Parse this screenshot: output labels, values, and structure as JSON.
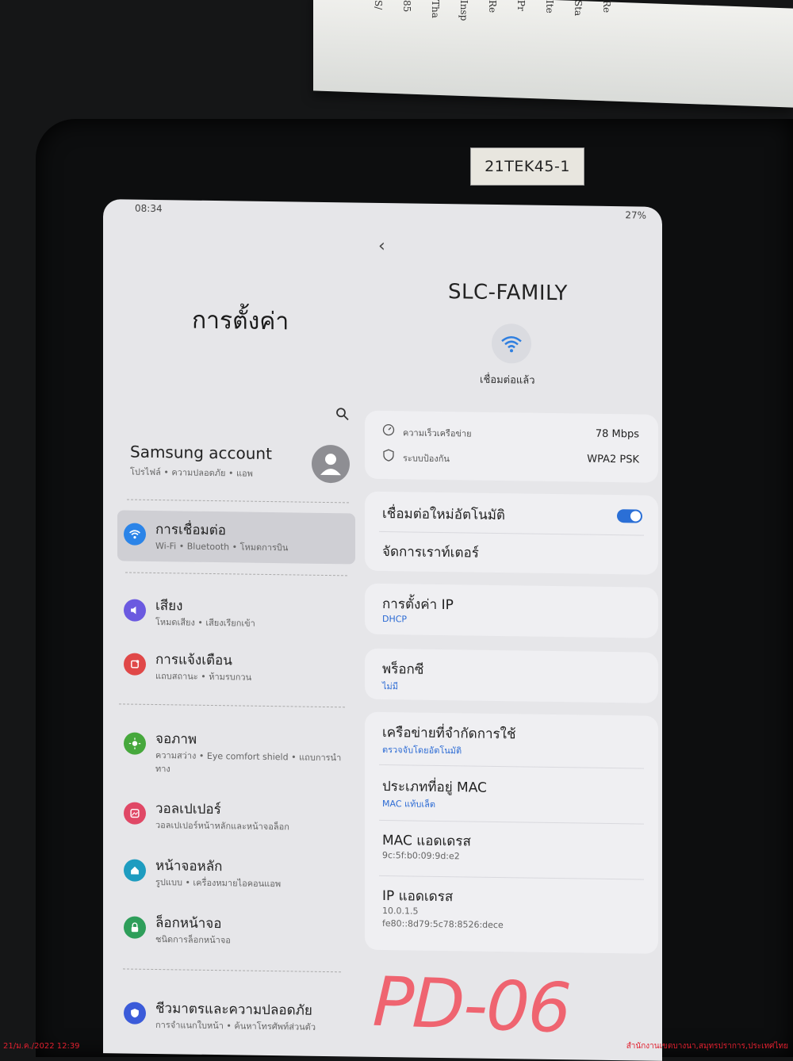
{
  "device_label": "21TEK45-1",
  "status_bar": {
    "time": "08:34",
    "battery": "27%"
  },
  "settings": {
    "title": "การตั้งค่า",
    "account": {
      "title": "Samsung account",
      "subtitle": "โปรไฟล์ • ความปลอดภัย • แอพ"
    },
    "items": [
      {
        "title": "การเชื่อมต่อ",
        "subtitle": "Wi-Fi • Bluetooth • โหมดการบิน",
        "icon": "wifi-icon",
        "color": "#2b84e8"
      },
      {
        "title": "เสียง",
        "subtitle": "โหมดเสียง • เสียงเรียกเข้า",
        "icon": "speaker-icon",
        "color": "#6b5ae0"
      },
      {
        "title": "การแจ้งเตือน",
        "subtitle": "แถบสถานะ • ห้ามรบกวน",
        "icon": "bell-icon",
        "color": "#e04848"
      },
      {
        "title": "จอภาพ",
        "subtitle": "ความสว่าง • Eye comfort shield • แถบการนำทาง",
        "icon": "sun-icon",
        "color": "#46a83c"
      },
      {
        "title": "วอลเปเปอร์",
        "subtitle": "วอลเปเปอร์หน้าหลักและหน้าจอล็อก",
        "icon": "wallpaper-icon",
        "color": "#e04866"
      },
      {
        "title": "หน้าจอหลัก",
        "subtitle": "รูปแบบ • เครื่องหมายไอคอนแอพ",
        "icon": "home-icon",
        "color": "#1e9cc0"
      },
      {
        "title": "ล็อกหน้าจอ",
        "subtitle": "ชนิดการล็อกหน้าจอ",
        "icon": "lock-icon",
        "color": "#2e9e5a"
      },
      {
        "title": "ชีวมาตรและความปลอดภัย",
        "subtitle": "การจำแนกใบหน้า • ค้นหาโทรศัพท์ส่วนตัว",
        "icon": "shield-icon",
        "color": "#3b5bd9"
      }
    ]
  },
  "network": {
    "name": "SLC-FAMILY",
    "status": "เชื่อมต่อแล้ว",
    "speed_label": "ความเร็วเครือข่าย",
    "speed_value": "78 Mbps",
    "security_label": "ระบบป้องกัน",
    "security_value": "WPA2 PSK",
    "auto_reconnect": "เชื่อมต่อใหม่อัตโนมัติ",
    "auto_reconnect_on": true,
    "manage_router": "จัดการเราท์เตอร์",
    "ip_settings": {
      "title": "การตั้งค่า IP",
      "value": "DHCP"
    },
    "proxy": {
      "title": "พร็อกซี",
      "value": "ไม่มี"
    },
    "metered": {
      "title": "เครือข่ายที่จำกัดการใช้",
      "value": "ตรวจจับโดยอัตโนมัติ"
    },
    "mac_type": {
      "title": "ประเภทที่อยู่ MAC",
      "value": "MAC แท้บเล็ต"
    },
    "mac_address": {
      "title": "MAC แอดเดรส",
      "value": "9c:5f:b0:09:9d:e2"
    },
    "ip_address": {
      "title": "IP แอดเดรส",
      "value_v4": "10.0.1.5",
      "value_v6": "fe80::8d79:5c78:8526:dece"
    }
  },
  "handwritten_label": "PD-06",
  "photo_stamp": {
    "date": "21/ม.ค./2022 12:39",
    "location": "สำนักงานเขตบางนา,สมุทรปราการ,ประเทศไทย"
  }
}
